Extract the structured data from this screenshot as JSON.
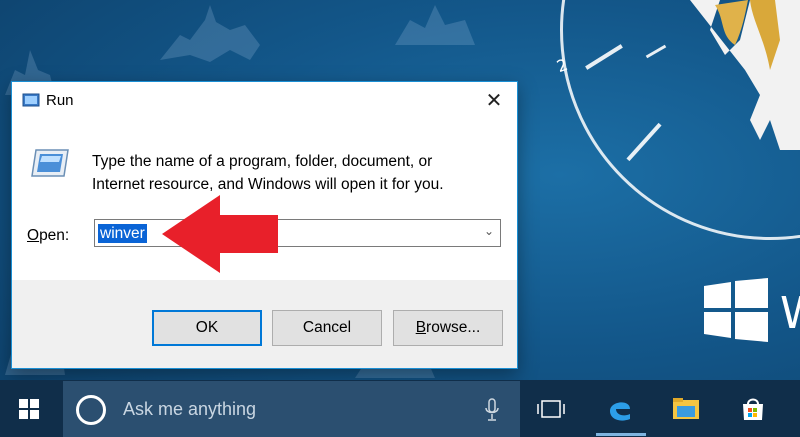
{
  "dialog": {
    "title": "Run",
    "close_glyph": "✕",
    "message_line1": "Type the name of a program, folder, document, or",
    "message_line2": "Internet resource, and Windows will open it for you.",
    "open_label_prefix": "",
    "open_label_mnemonic": "O",
    "open_label_rest": "pen:",
    "open_value": "winver",
    "dropdown_glyph": "⌄",
    "buttons": {
      "ok": "OK",
      "cancel": "Cancel",
      "browse_mnemonic": "B",
      "browse_rest": "rowse..."
    },
    "annotation_color": "#e8202a"
  },
  "desktop": {
    "clock_numbers": [
      "2"
    ],
    "brand_text": "W"
  },
  "taskbar": {
    "search_placeholder": "Ask me anything",
    "icons": [
      "windows-start-icon",
      "cortana-icon",
      "microphone-icon",
      "task-view-icon",
      "edge-icon",
      "file-explorer-icon",
      "store-icon"
    ]
  }
}
